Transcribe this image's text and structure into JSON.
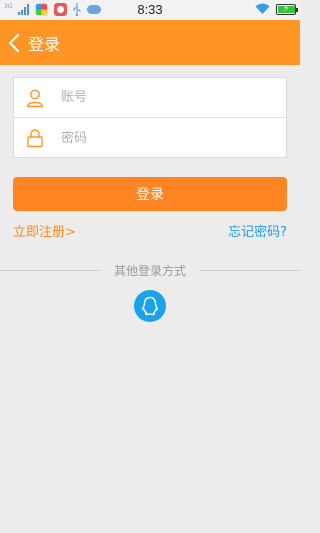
{
  "status_bar": {
    "network": "3G",
    "time": "8:33"
  },
  "header": {
    "title": "登录"
  },
  "form": {
    "account_placeholder": "账号",
    "password_placeholder": "密码"
  },
  "actions": {
    "login_label": "登录",
    "register_label": "立即注册>",
    "forgot_label": "忘记密码?"
  },
  "other_login": {
    "label": "其他登录方式"
  },
  "colors": {
    "header_bg": "#ff9524",
    "accent_orange": "#ff8522",
    "link_blue": "#1e9fe0",
    "qq_blue": "#1aa3ea",
    "page_bg": "#ececec"
  },
  "icons": {
    "account": "user-icon",
    "password": "lock-icon",
    "back": "chevron-left-icon",
    "qq": "qq-penguin-icon"
  }
}
